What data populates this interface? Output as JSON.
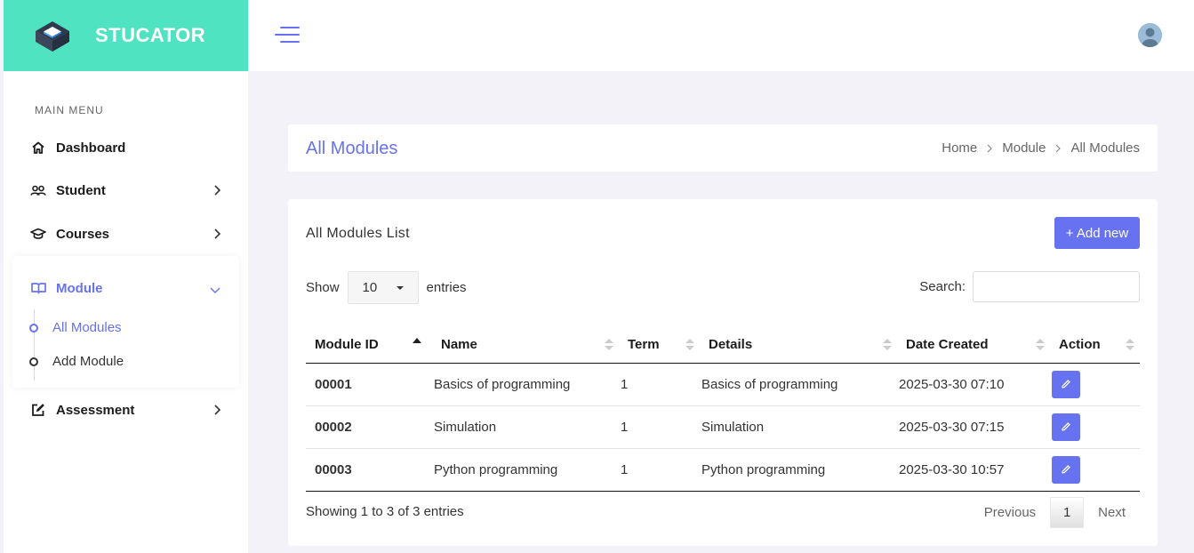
{
  "brand": {
    "name": "STUCATOR",
    "accent_color": "#4fe3c1",
    "primary_color": "#6772f0"
  },
  "sidebar": {
    "menu_title": "MAIN MENU",
    "items": [
      {
        "label": "Dashboard",
        "icon": "home-icon"
      },
      {
        "label": "Student",
        "icon": "users-icon"
      },
      {
        "label": "Courses",
        "icon": "graduation-cap-icon"
      },
      {
        "label": "Module",
        "icon": "book-icon",
        "expanded": true,
        "children": [
          {
            "label": "All Modules",
            "active": true
          },
          {
            "label": "Add Module"
          }
        ]
      },
      {
        "label": "Assessment",
        "icon": "edit-icon"
      }
    ]
  },
  "page": {
    "title": "All Modules",
    "breadcrumb": [
      "Home",
      "Module",
      "All Modules"
    ]
  },
  "card": {
    "title": "All Modules List",
    "add_button": "+ Add new",
    "show_label": "Show",
    "entries_label": "entries",
    "page_length": "10",
    "search_label": "Search:",
    "search_value": "",
    "columns": [
      "Module ID",
      "Name",
      "Term",
      "Details",
      "Date Created",
      "Action"
    ],
    "rows": [
      {
        "id": "00001",
        "name": "Basics of programming",
        "term": "1",
        "details": "Basics of programming",
        "date": "2025-03-30 07:10"
      },
      {
        "id": "00002",
        "name": "Simulation",
        "term": "1",
        "details": "Simulation",
        "date": "2025-03-30 07:15"
      },
      {
        "id": "00003",
        "name": "Python programming",
        "term": "1",
        "details": "Python programming",
        "date": "2025-03-30 10:57"
      }
    ],
    "info": "Showing 1 to 3 of 3 entries",
    "pagination": {
      "previous": "Previous",
      "current": "1",
      "next": "Next"
    }
  }
}
